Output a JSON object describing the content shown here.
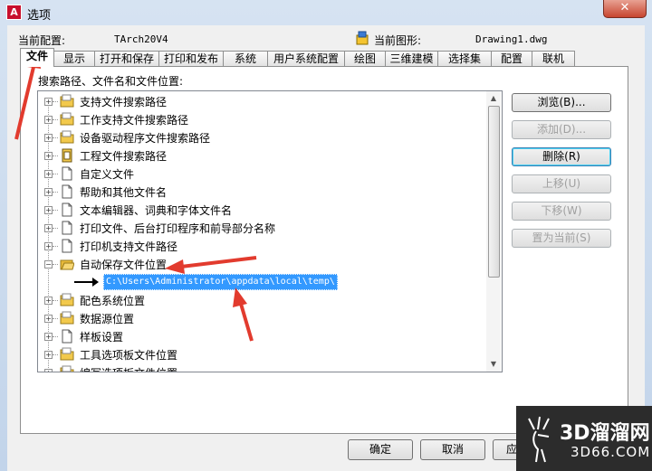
{
  "window": {
    "title": "选项",
    "close_label": "✕"
  },
  "header": {
    "profile_label": "当前配置:",
    "profile_value": "TArch20V4",
    "drawing_label": "当前图形:",
    "drawing_value": "Drawing1.dwg"
  },
  "tabs": [
    "文件",
    "显示",
    "打开和保存",
    "打印和发布",
    "系统",
    "用户系统配置",
    "绘图",
    "三维建模",
    "选择集",
    "配置",
    "联机"
  ],
  "panel_label": "搜索路径、文件名和文件位置:",
  "tree": {
    "items": [
      {
        "label": "支持文件搜索路径",
        "icon": "folder-icon",
        "expanded": false
      },
      {
        "label": "工作支持文件搜索路径",
        "icon": "folder-icon",
        "expanded": false
      },
      {
        "label": "设备驱动程序文件搜索路径",
        "icon": "folder-icon",
        "expanded": false
      },
      {
        "label": "工程文件搜索路径",
        "icon": "project-icon",
        "expanded": false
      },
      {
        "label": "自定义文件",
        "icon": "file-icon",
        "expanded": false
      },
      {
        "label": "帮助和其他文件名",
        "icon": "file-icon",
        "expanded": false
      },
      {
        "label": "文本编辑器、词典和字体文件名",
        "icon": "file-icon",
        "expanded": false
      },
      {
        "label": "打印文件、后台打印程序和前导部分名称",
        "icon": "file-icon",
        "expanded": false
      },
      {
        "label": "打印机支持文件路径",
        "icon": "file-icon",
        "expanded": false
      },
      {
        "label": "自动保存文件位置",
        "icon": "folder-open-icon",
        "expanded": true
      },
      {
        "label": "配色系统位置",
        "icon": "folder-icon",
        "expanded": false
      },
      {
        "label": "数据源位置",
        "icon": "folder-icon",
        "expanded": false
      },
      {
        "label": "样板设置",
        "icon": "file-icon",
        "expanded": false
      },
      {
        "label": "工具选项板文件位置",
        "icon": "folder-icon",
        "expanded": false
      },
      {
        "label": "编写选项板文件位置",
        "icon": "folder-icon",
        "expanded": false
      }
    ],
    "selected_path": "C:\\Users\\Administrator\\appdata\\local\\temp\\"
  },
  "side_buttons": {
    "browse": "浏览(B)...",
    "add": "添加(D)...",
    "remove": "删除(R)",
    "move_up": "上移(U)",
    "move_down": "下移(W)",
    "set_current": "置为当前(S)"
  },
  "footer": {
    "ok": "确定",
    "cancel": "取消",
    "apply": "应"
  },
  "watermark": {
    "brand": "3D溜溜网",
    "url": "3D66.COM"
  },
  "colors": {
    "selection": "#3399ff",
    "annotation": "#e23b2e"
  }
}
